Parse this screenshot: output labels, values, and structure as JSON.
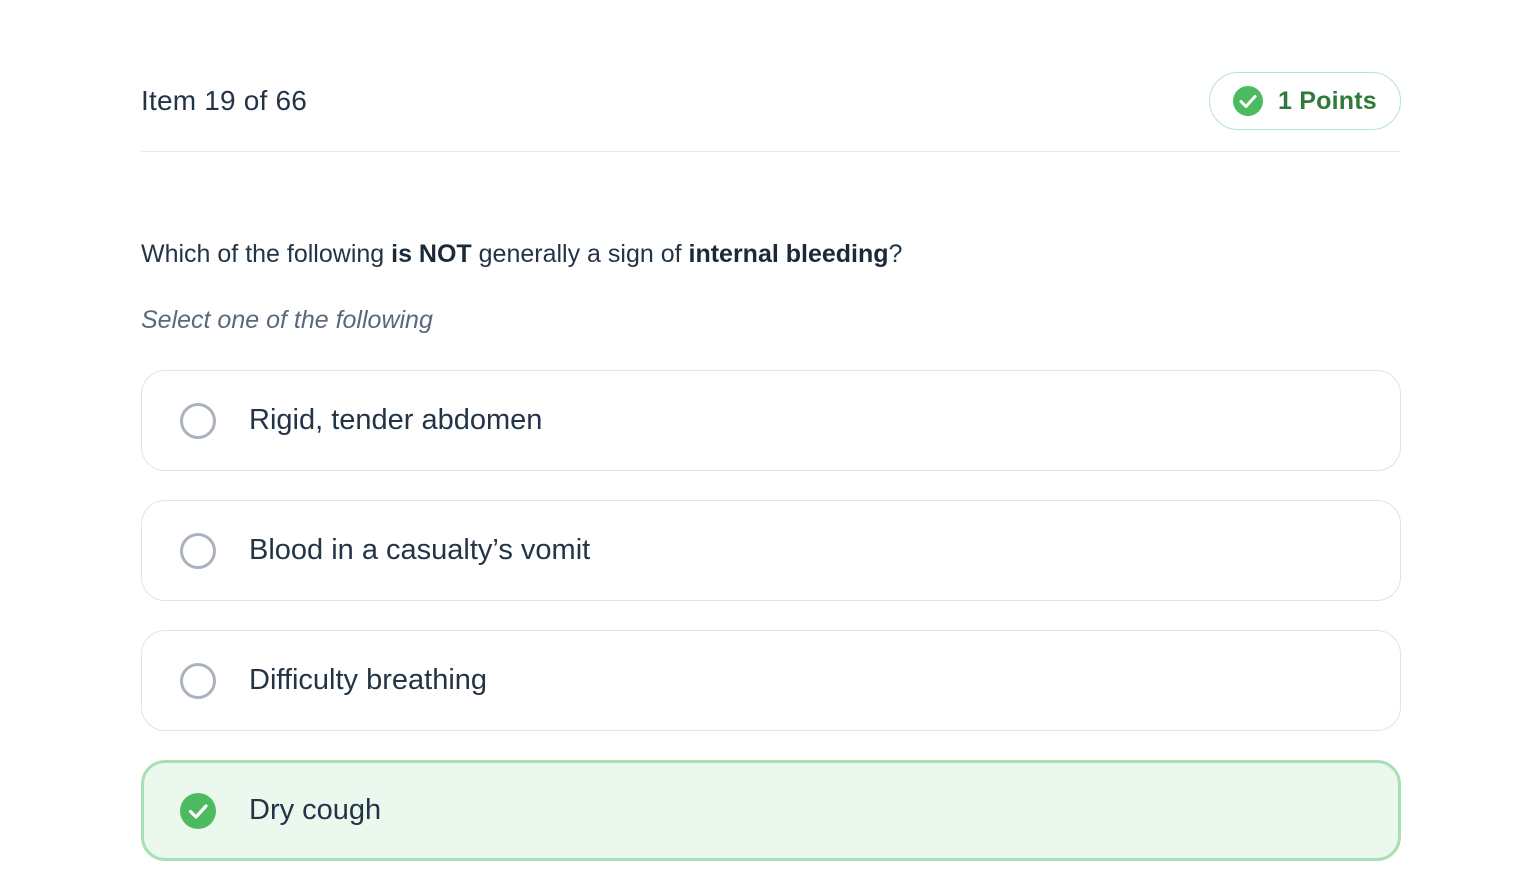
{
  "header": {
    "item_counter": "Item 19 of 66",
    "points_label": "1 Points"
  },
  "question": {
    "part1": "Which of the following ",
    "part2_bold": "is NOT",
    "part3": " generally a sign of ",
    "part4_bold": "internal bleeding",
    "part5": "?",
    "instruction": "Select one of the following"
  },
  "options": [
    {
      "label": "Rigid, tender abdomen",
      "selected": false
    },
    {
      "label": "Blood in a casualty’s vomit",
      "selected": false
    },
    {
      "label": "Difficulty breathing",
      "selected": false
    },
    {
      "label": "Dry cough",
      "selected": true
    }
  ],
  "icons": {
    "badge_icon": "check-circle-icon",
    "selected_icon": "check-circle-icon"
  },
  "colors": {
    "accent_green": "#4cbb5f",
    "badge_text": "#2f7a3b",
    "selected_border": "#a8e0b6",
    "selected_bg": "#ebf8ee"
  }
}
